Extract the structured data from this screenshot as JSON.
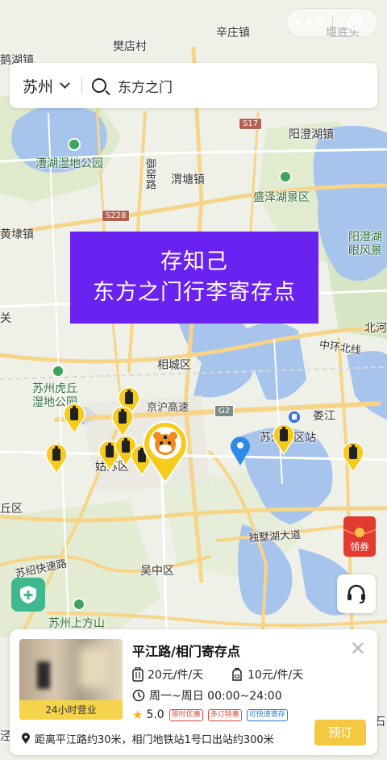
{
  "top_actions": {
    "more_glyph": "•••",
    "target_icon": "target-icon"
  },
  "search": {
    "city": "苏州",
    "query": "东方之门"
  },
  "promo": {
    "line1": "存知己",
    "line2": "东方之门行李寄存点"
  },
  "map_labels": {
    "l1": "樊店村",
    "l2": "辛庄镇",
    "l3": "堰底头",
    "l4": "鹅湖镇",
    "l5": "漕湖湿地公园",
    "l6": "御窑路",
    "l7": "渭塘镇",
    "l8": "阳澄湖镇",
    "l9": "盛泽湖景区",
    "l10": "黄埭镇",
    "l11": "阳澄湖眼风景",
    "l12": "相城区",
    "l13": "北河",
    "l14": "中环北线",
    "l15": "苏州虎丘湿地公园",
    "l16": "京沪高速",
    "l17": "娄江",
    "l18": "苏州园区站",
    "l19": "姑苏区",
    "l20": "丘区",
    "l21": "独墅湖大道",
    "l22": "吴中区",
    "l23": "苏绍快速路",
    "l24": "苏州上方山",
    "l25": "关",
    "l26": "石",
    "l27": "泾",
    "l28": "北"
  },
  "road_shields": {
    "s17": "S17",
    "s228": "S228",
    "g2": "G2"
  },
  "coupon": {
    "label": "领券"
  },
  "card": {
    "title": "平江路/相门寄存点",
    "badge": "24小时营业",
    "price_large": "20元/件/天",
    "price_small": "10元/件/天",
    "open_hours": "周一~周日 00:00~24:00",
    "rating": "5.0",
    "tags": [
      "限时优惠",
      "多订特惠",
      "可快速寄存"
    ],
    "address": "距离平江路约30米，相门地铁站1号口出站约300米",
    "book_label": "预订",
    "close_glyph": "✕"
  }
}
